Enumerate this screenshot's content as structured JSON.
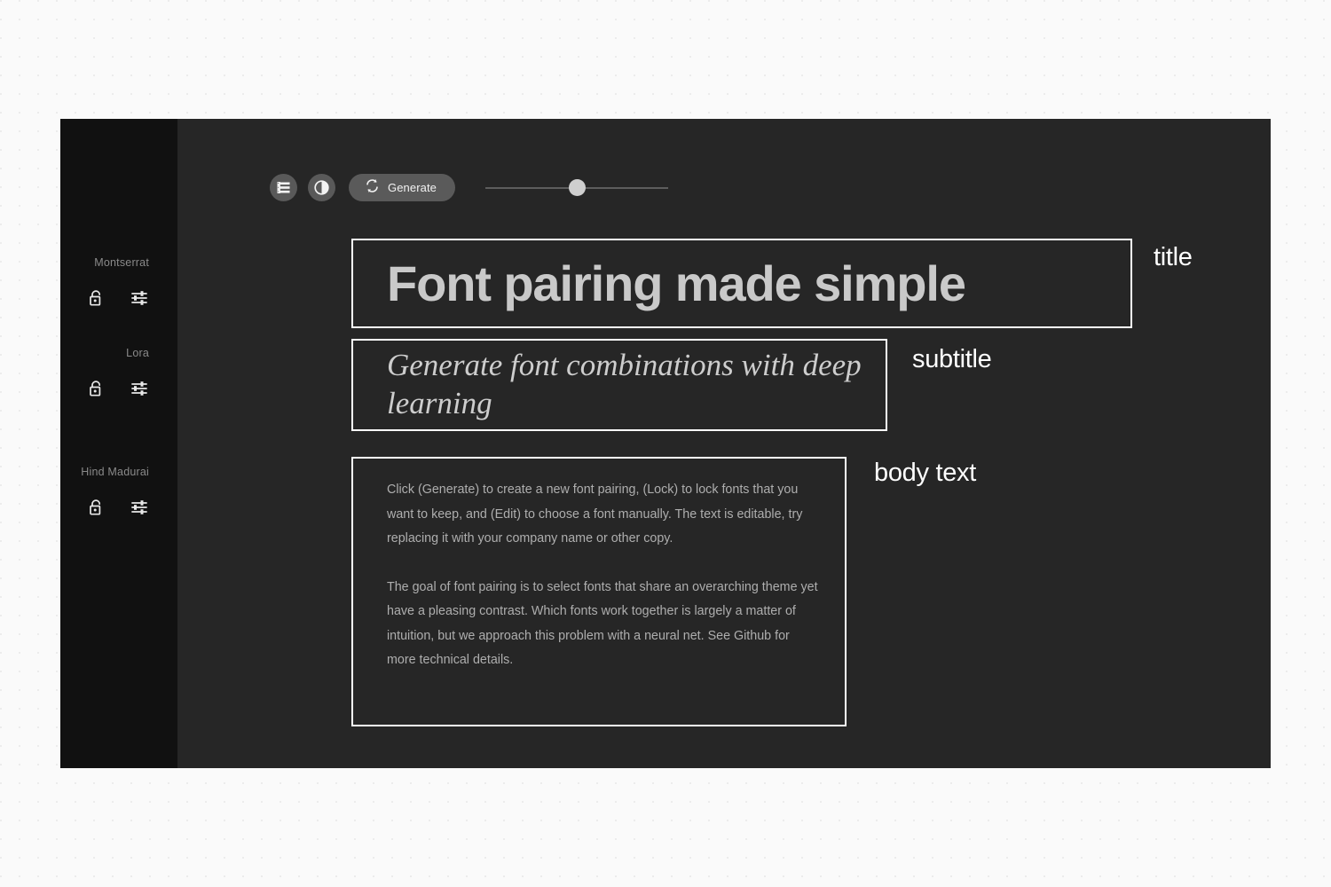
{
  "sidebar": {
    "fonts": [
      {
        "name": "Montserrat",
        "lock_icon": "unlock-icon",
        "edit_icon": "tune-icon"
      },
      {
        "name": "Lora",
        "lock_icon": "unlock-icon",
        "edit_icon": "tune-icon"
      },
      {
        "name": "Hind Madurai",
        "lock_icon": "unlock-icon",
        "edit_icon": "tune-icon"
      }
    ]
  },
  "toolbar": {
    "list_button_icon": "list-icon",
    "contrast_button_icon": "contrast-icon",
    "generate_label": "Generate",
    "generate_icon": "refresh-icon",
    "slider": {
      "value_percent": 50
    }
  },
  "content": {
    "title": "Font pairing made simple",
    "subtitle": "Generate font combinations with deep learning",
    "body_paragraphs": [
      "Click (Generate) to create a new font pairing, (Lock) to lock fonts that you want to keep, and (Edit) to choose a font manually. The text is editable, try replacing it with your company name or other copy.",
      "The goal of font pairing is to select fonts that share an overarching theme yet have a pleasing contrast. Which fonts work together is largely a matter of intuition, but we approach this problem with a neural net. See Github for more technical details."
    ]
  },
  "annotations": {
    "title": "title",
    "subtitle": "subtitle",
    "body": "body text"
  },
  "colors": {
    "page_background": "#fafafa",
    "sidebar_background": "#111111",
    "panel_background": "#262626",
    "outline": "#ffffff",
    "title_text": "#c9c9c9",
    "body_text": "#aeaeae",
    "button_fill": "#5a5a5a"
  }
}
